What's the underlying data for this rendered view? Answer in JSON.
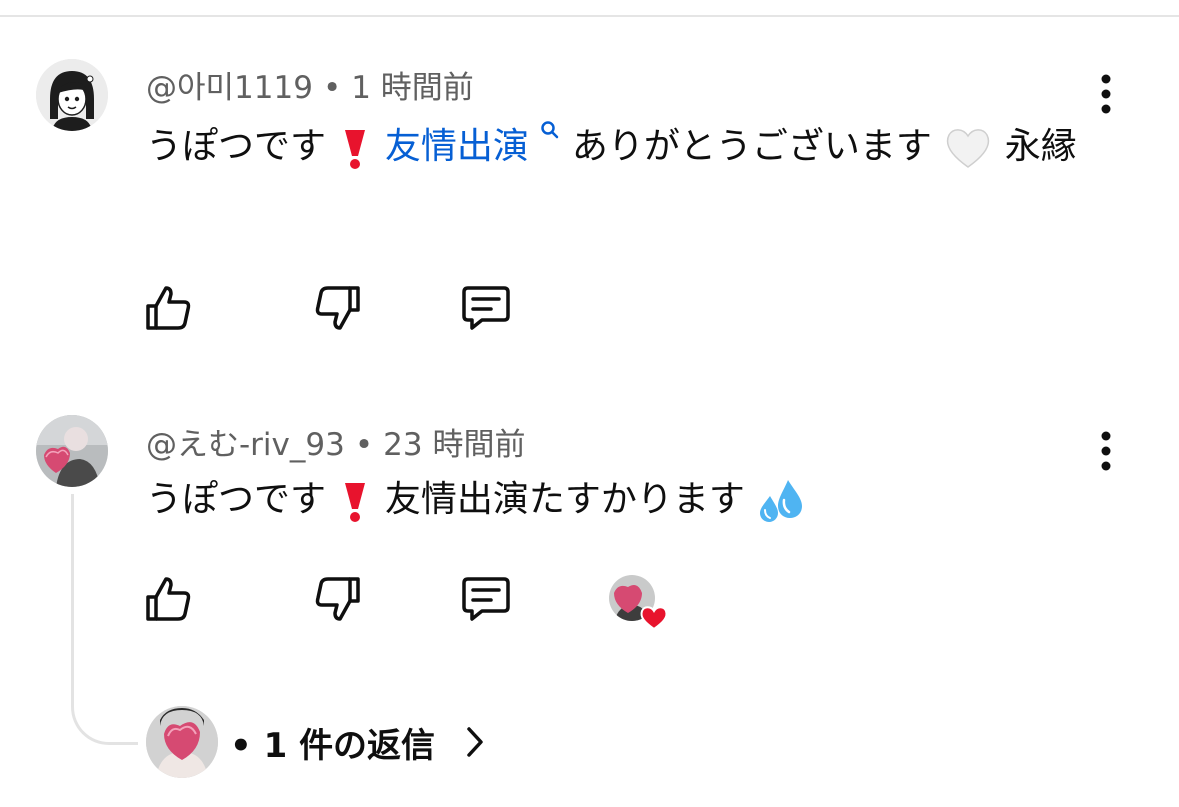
{
  "comments": [
    {
      "author": "@아미1119",
      "separator": "•",
      "time": "1 時間前",
      "text_before": "うぽつです",
      "emoji1": "red-exclamation-emoji",
      "link_text": "友情出演",
      "text_after": "ありがとうございます",
      "emoji2": "white-heart-emoji",
      "text_end": "永縁",
      "avatar_icon": "cartoon-girl-avatar",
      "actions": [
        "like-icon",
        "dislike-icon",
        "reply-icon"
      ]
    },
    {
      "author": "@えむ-riv_93",
      "separator": "•",
      "time": "23 時間前",
      "text_before": "うぽつです",
      "emoji1": "red-exclamation-emoji",
      "text_after": "友情出演たすかります",
      "emoji2": "sweat-droplets-emoji",
      "avatar_icon": "photo-avatar",
      "actions": [
        "like-icon",
        "dislike-icon",
        "reply-icon",
        "creator-heart-icon"
      ]
    }
  ],
  "replies": {
    "label": "• 1 件の返信",
    "chevron": "chevron-right-icon"
  },
  "colors": {
    "link": "#065fd4",
    "meta": "#606060",
    "heart": "#e8132d",
    "text": "#0f0f0f"
  }
}
